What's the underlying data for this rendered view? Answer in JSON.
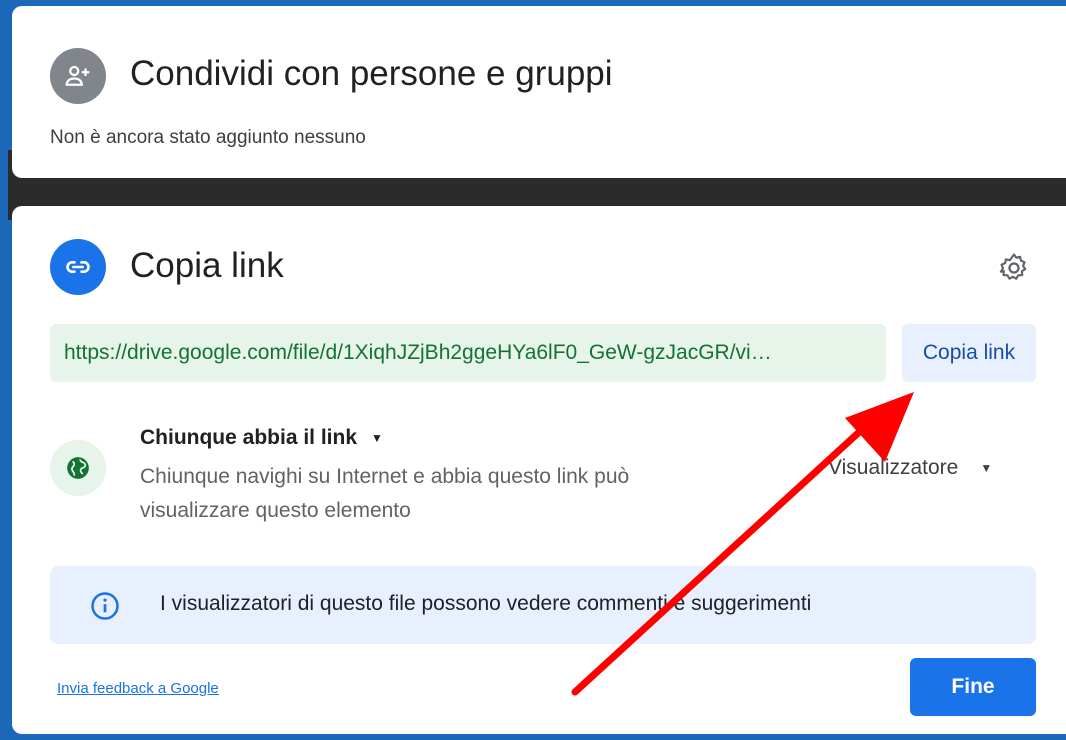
{
  "share_card": {
    "title": "Condividi con persone e gruppi",
    "subtitle": "Non è ancora stato aggiunto nessuno",
    "icon": "person-add-icon"
  },
  "link_card": {
    "title": "Copia link",
    "icon": "link-icon",
    "settings_icon": "gear-icon",
    "url": "https://drive.google.com/file/d/1XiqhJZjBh2ggeHYa6lF0_GeW-gzJacGR/vi…",
    "copy_button": "Copia link",
    "access": {
      "title": "Chiunque abbia il link",
      "description": "Chiunque navighi su Internet e abbia questo link può visualizzare questo elemento",
      "icon": "globe-icon",
      "role": "Visualizzatore"
    },
    "info": {
      "icon": "info-icon",
      "text": "I visualizzatori di questo file possono vedere commenti e suggerimenti"
    },
    "feedback_link": "Invia feedback a Google",
    "done_button": "Fine"
  },
  "colors": {
    "accent": "#1a73e8",
    "url_green": "#137333",
    "annotation_arrow": "#ff0000"
  }
}
